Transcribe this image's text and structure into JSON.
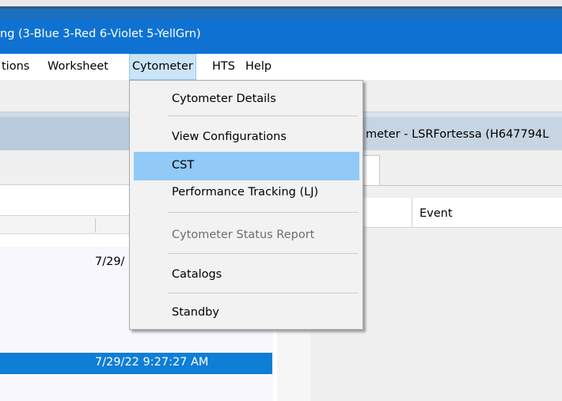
{
  "window": {
    "title": "ng (3-Blue 3-Red 6-Violet 5-YellGrn)"
  },
  "menubar": {
    "items": [
      "tions",
      "Worksheet",
      "Cytometer",
      "HTS",
      "Help"
    ],
    "active": "Cytometer"
  },
  "dropdown": {
    "items": [
      {
        "label": "Cytometer Details",
        "state": "normal"
      },
      {
        "label": "View Configurations",
        "state": "normal"
      },
      {
        "label": "CST",
        "state": "highlighted"
      },
      {
        "label": "Performance Tracking (LJ)",
        "state": "normal"
      },
      {
        "label": "Cytometer Status Report",
        "state": "disabled"
      },
      {
        "label": "Catalogs",
        "state": "normal"
      },
      {
        "label": "Standby",
        "state": "normal"
      }
    ]
  },
  "left_panel": {
    "rows": [
      {
        "date": "7/29/",
        "selected": false
      },
      {
        "date": "7/29/22 9:27:27 AM",
        "selected": true
      }
    ]
  },
  "right_panel": {
    "title": "meter - LSRFortessa (H647794L",
    "columns": [
      "Event"
    ]
  },
  "colors": {
    "titlebar": "#0f72d3",
    "menu_active": "#cce4f7",
    "dropdown_highlight": "#91c9f7",
    "selected_row": "#0f7ed6"
  }
}
